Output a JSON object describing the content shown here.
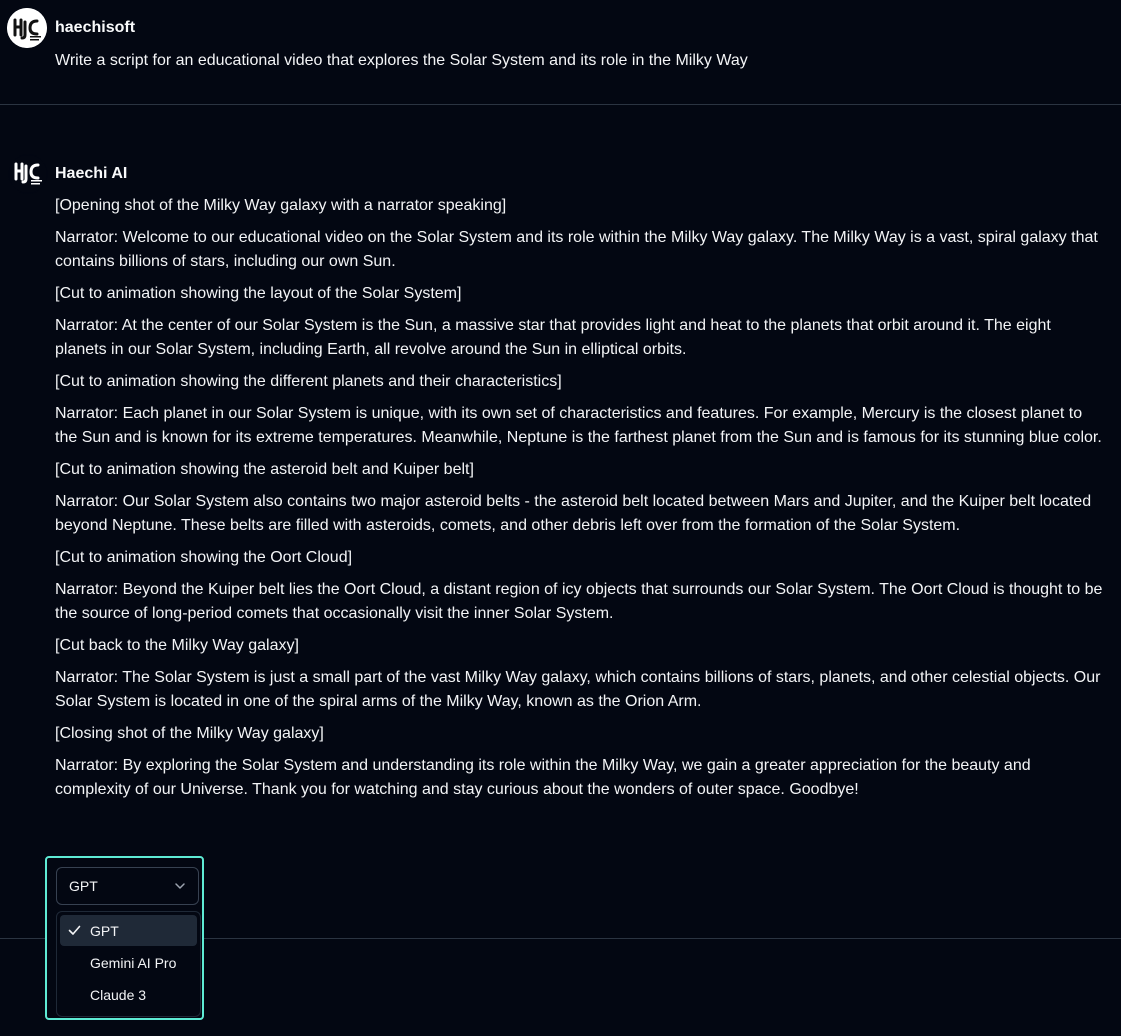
{
  "user_message": {
    "author": "haechisoft",
    "text": "Write a script for an educational video that explores the Solar System and its role in the Milky Way",
    "avatar_icon": "haechisoft-logo-icon"
  },
  "ai_message": {
    "author": "Haechi AI",
    "avatar_icon": "haechi-ai-logo-icon",
    "paragraphs": [
      "[Opening shot of the Milky Way galaxy with a narrator speaking]",
      "Narrator: Welcome to our educational video on the Solar System and its role within the Milky Way galaxy. The Milky Way is a vast, spiral galaxy that contains billions of stars, including our own Sun.",
      "[Cut to animation showing the layout of the Solar System]",
      "Narrator: At the center of our Solar System is the Sun, a massive star that provides light and heat to the planets that orbit around it. The eight planets in our Solar System, including Earth, all revolve around the Sun in elliptical orbits.",
      "[Cut to animation showing the different planets and their characteristics]",
      "Narrator: Each planet in our Solar System is unique, with its own set of characteristics and features. For example, Mercury is the closest planet to the Sun and is known for its extreme temperatures. Meanwhile, Neptune is the farthest planet from the Sun and is famous for its stunning blue color.",
      "[Cut to animation showing the asteroid belt and Kuiper belt]",
      "Narrator: Our Solar System also contains two major asteroid belts - the asteroid belt located between Mars and Jupiter, and the Kuiper belt located beyond Neptune. These belts are filled with asteroids, comets, and other debris left over from the formation of the Solar System.",
      "[Cut to animation showing the Oort Cloud]",
      "Narrator: Beyond the Kuiper belt lies the Oort Cloud, a distant region of icy objects that surrounds our Solar System. The Oort Cloud is thought to be the source of long-period comets that occasionally visit the inner Solar System.",
      "[Cut back to the Milky Way galaxy]",
      "Narrator: The Solar System is just a small part of the vast Milky Way galaxy, which contains billions of stars, planets, and other celestial objects. Our Solar System is located in one of the spiral arms of the Milky Way, known as the Orion Arm.",
      "[Closing shot of the Milky Way galaxy]",
      "Narrator: By exploring the Solar System and understanding its role within the Milky Way, we gain a greater appreciation for the beauty and complexity of our Universe. Thank you for watching and stay curious about the wonders of outer space. Goodbye!"
    ]
  },
  "model_select": {
    "selected": "GPT",
    "options": [
      "GPT",
      "Gemini AI Pro",
      "Claude 3"
    ],
    "trigger_icon": "chevron-down-icon",
    "selected_icon": "check-icon"
  },
  "colors": {
    "background": "#030712",
    "text": "#f3f4f6",
    "divider": "#2b3441",
    "focus_ring": "#5eead4",
    "option_highlight": "#1f2937"
  }
}
